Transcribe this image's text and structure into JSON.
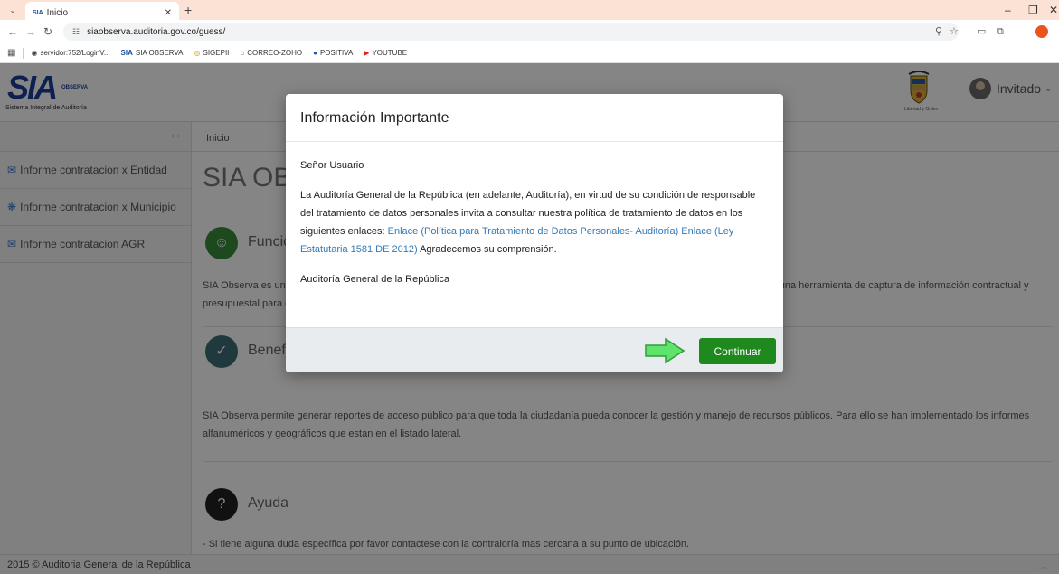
{
  "browser": {
    "tab_title": "Inicio",
    "tab_favicon": "SIA",
    "url": "siaobserva.auditoria.gov.co/guess/",
    "bookmarks": [
      {
        "label": "servidor:752/LoginV...",
        "icon": "globe-icon",
        "color": "#444444"
      },
      {
        "label": "SIA OBSERVA",
        "icon": "sia-icon",
        "color": "#1a4d9c"
      },
      {
        "label": "SIGEPII",
        "icon": "sigep-icon",
        "color": "#c8a200"
      },
      {
        "label": "CORREO-ZOHO",
        "icon": "home-icon",
        "color": "#2a7fd4"
      },
      {
        "label": "POSITIVA",
        "icon": "positiva-icon",
        "color": "#1c4fb8"
      },
      {
        "label": "YOUTUBE",
        "icon": "youtube-icon",
        "color": "#e62117"
      }
    ]
  },
  "header": {
    "logo_big": "SIA",
    "logo_small": "OBSERVA",
    "logo_sub": "Sistema Integral de Auditoría",
    "crest_caption": "Libertad y Orden",
    "user_name": "Invitado"
  },
  "sidebar": {
    "items": [
      {
        "label": "Informe contratacion x Entidad",
        "icon": "inbox-icon"
      },
      {
        "label": "Informe contratacion x Municipio",
        "icon": "gear-icon"
      },
      {
        "label": "Informe contratacion AGR",
        "icon": "inbox-icon"
      }
    ]
  },
  "main": {
    "breadcrumb": "Inicio",
    "title": "SIA OBSERVA",
    "sections": [
      {
        "title": "Funcionalidad",
        "icon": "users-icon",
        "color": "#3a8a3a",
        "text": "SIA Observa es una aplicación web que brinda a los sujetos vigilados por la Auditoría General de la República y a las contralorías, una herramienta de captura de información contractual y presupuestal para el ejercicio del control fiscal."
      },
      {
        "title": "Beneficios",
        "icon": "check-circle-icon",
        "color": "#3d6e73",
        "text": "SIA Observa permite generar reportes de acceso público para que toda la ciudadanía pueda conocer la gestión y manejo de recursos públicos. Para ello se han implementado los informes alfanuméricos y geográficos que estan en el listado lateral."
      },
      {
        "title": "Ayuda",
        "icon": "question-icon",
        "color": "#222222",
        "text": "- Si tiene alguna duda específica por favor contactese con la contraloría mas cercana a su punto de ubicación."
      }
    ]
  },
  "footer": {
    "text": "2015 © Auditoria General de la República"
  },
  "modal": {
    "title": "Información Importante",
    "greeting": "Señor Usuario",
    "body_1": "La Auditoría General de la República (en adelante, Auditoría), en virtud de su condición de responsable del tratamiento de datos personales invita a consultar nuestra política de tratamiento de datos en los siguientes enlaces: ",
    "link_1": "Enlace (Política para Tratamiento de Datos Personales- Auditoría)",
    "link_2": " Enlace (Ley Estatutaria 1581 DE 2012)",
    "body_2": " Agradecemos su comprensión.",
    "signature": "Auditoría General de la República",
    "button_label": "Continuar",
    "arrow_color": "#5ee36b"
  }
}
